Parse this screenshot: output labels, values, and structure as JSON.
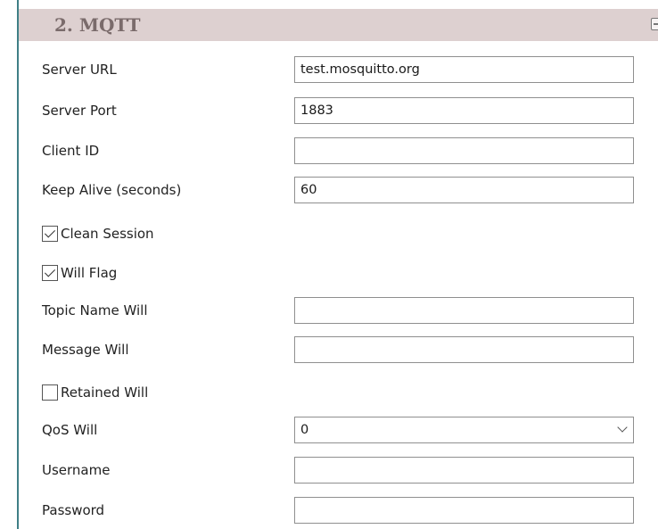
{
  "panel": {
    "title": "2. MQTT",
    "collapse_icon": "minus-square-icon"
  },
  "fields": {
    "server_url": {
      "label": "Server URL",
      "value": "test.mosquitto.org"
    },
    "server_port": {
      "label": "Server Port",
      "value": "1883"
    },
    "client_id": {
      "label": "Client ID",
      "value": ""
    },
    "keep_alive": {
      "label": "Keep Alive (seconds)",
      "value": "60"
    },
    "clean_session": {
      "label": "Clean Session",
      "checked": true
    },
    "will_flag": {
      "label": "Will Flag",
      "checked": true
    },
    "topic_name_will": {
      "label": "Topic Name Will",
      "value": ""
    },
    "message_will": {
      "label": "Message Will",
      "value": ""
    },
    "retained_will": {
      "label": "Retained Will",
      "checked": false
    },
    "qos_will": {
      "label": "QoS Will",
      "value": "0"
    },
    "username": {
      "label": "Username",
      "value": ""
    },
    "password": {
      "label": "Password",
      "value": ""
    }
  },
  "colors": {
    "header_bg": "#ddd0d0",
    "header_text": "#7a6b6b",
    "left_border": "#3f7f86"
  }
}
